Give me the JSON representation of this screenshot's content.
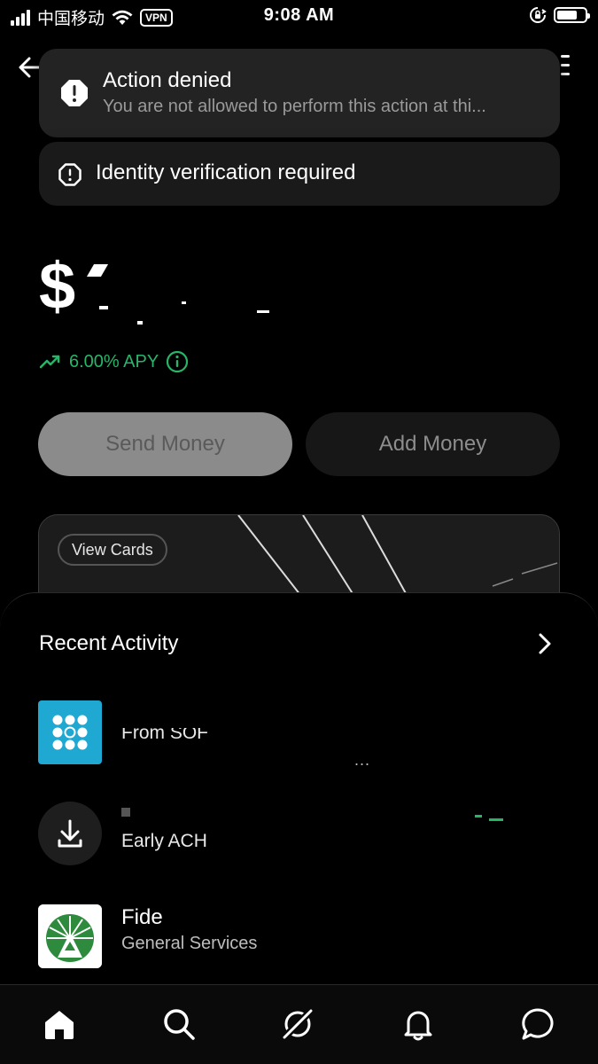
{
  "status_bar": {
    "carrier": "中国移动",
    "vpn": "VPN",
    "time": "9:08 AM"
  },
  "toasts": [
    {
      "title": "Action denied",
      "message": "You are not allowed to perform this action at thi...",
      "icon": "alert-octagon-icon"
    },
    {
      "title": "Identity verification required",
      "icon": "alert-circle-icon"
    }
  ],
  "balance": {
    "amount": "$"
  },
  "apy": {
    "label": "6.00% APY",
    "color": "#27b56a"
  },
  "actions": {
    "send": "Send Money",
    "add": "Add Money"
  },
  "card": {
    "view_cards": "View Cards"
  },
  "recent_activity": {
    "title": "Recent Activity",
    "items": [
      {
        "title": "From SOF",
        "sub": "...",
        "icon": "sofi-logo-icon"
      },
      {
        "title": "Early ACH",
        "icon": "download-icon"
      },
      {
        "title": "Fide",
        "sub": "General Services",
        "icon": "fidelity-logo-icon"
      }
    ]
  },
  "tabs": [
    "home-icon",
    "search-icon",
    "orbit-icon",
    "bell-icon",
    "chat-icon"
  ]
}
